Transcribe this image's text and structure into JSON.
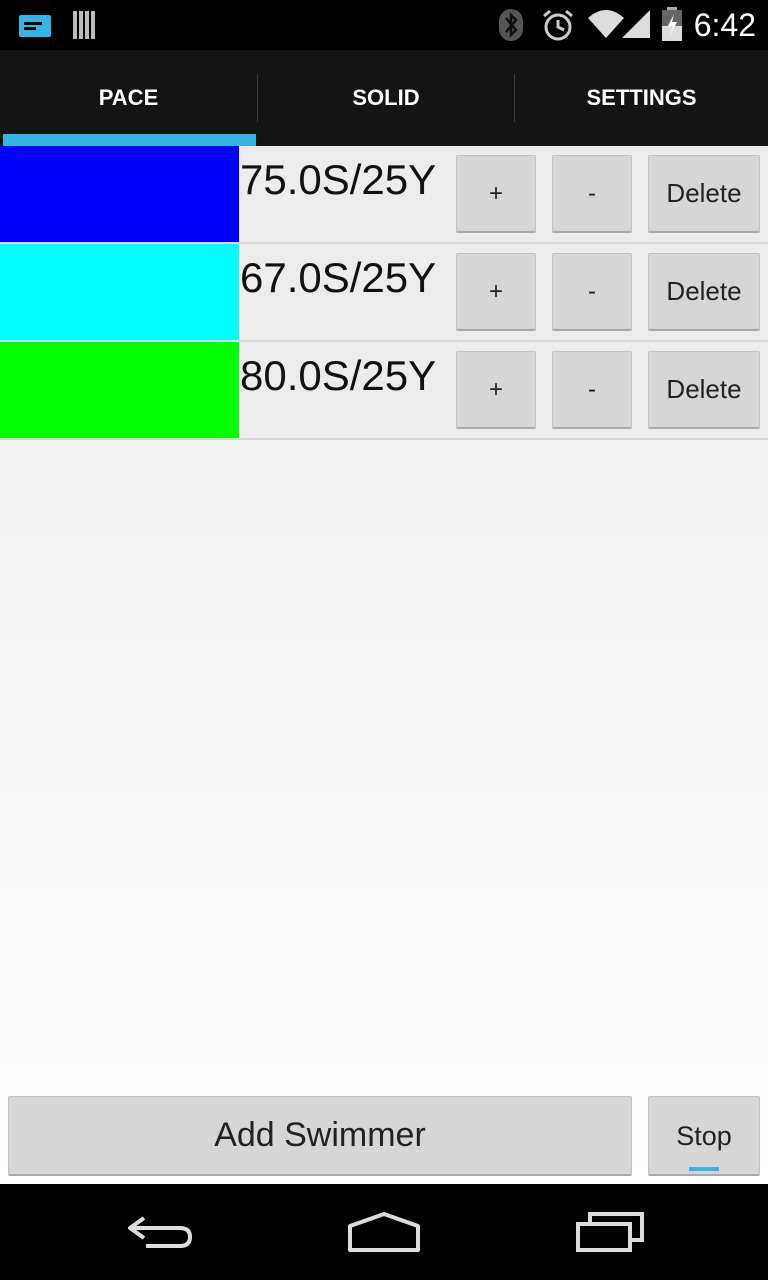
{
  "status_bar": {
    "time": "6:42",
    "icons": [
      "notification-icon",
      "sd-card-icon",
      "bluetooth-icon",
      "alarm-icon",
      "wifi-icon",
      "signal-icon",
      "battery-icon"
    ]
  },
  "tabs": [
    {
      "label": "PACE",
      "selected": true
    },
    {
      "label": "SOLID",
      "selected": false
    },
    {
      "label": "SETTINGS",
      "selected": false
    }
  ],
  "swimmers": [
    {
      "color": "#0000ff",
      "pace": "75.0S/25Y",
      "plus": "+",
      "minus": "-",
      "delete": "Delete"
    },
    {
      "color": "#00ffff",
      "pace": "67.0S/25Y",
      "plus": "+",
      "minus": "-",
      "delete": "Delete"
    },
    {
      "color": "#00ff00",
      "pace": "80.0S/25Y",
      "plus": "+",
      "minus": "-",
      "delete": "Delete"
    }
  ],
  "footer": {
    "add_label": "Add Swimmer",
    "stop_label": "Stop"
  },
  "colors": {
    "accent": "#33b5e5"
  },
  "nav_bar": {
    "icons": [
      "back-icon",
      "home-icon",
      "recents-icon"
    ]
  }
}
